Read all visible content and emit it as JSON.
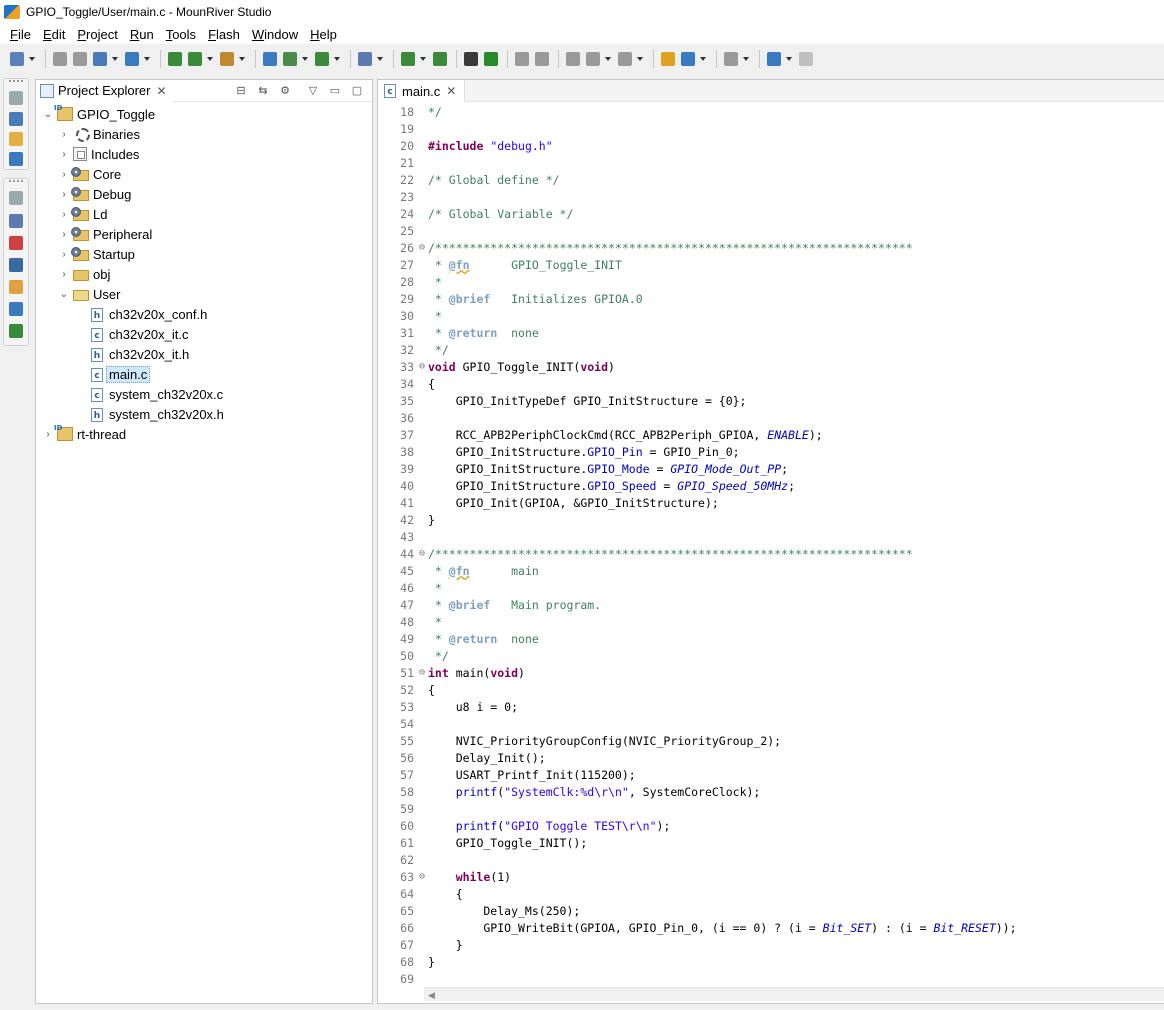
{
  "window": {
    "title": "GPIO_Toggle/User/main.c - MounRiver Studio"
  },
  "menu": [
    {
      "label": "File",
      "mnemonic": "F",
      "rest": "ile"
    },
    {
      "label": "Edit",
      "mnemonic": "E",
      "rest": "dit"
    },
    {
      "label": "Project",
      "mnemonic": "P",
      "rest": "roject"
    },
    {
      "label": "Run",
      "mnemonic": "R",
      "rest": "un"
    },
    {
      "label": "Tools",
      "mnemonic": "T",
      "rest": "ools"
    },
    {
      "label": "Flash",
      "mnemonic": "F",
      "rest": "lash"
    },
    {
      "label": "Window",
      "mnemonic": "W",
      "rest": "indow"
    },
    {
      "label": "Help",
      "mnemonic": "H",
      "rest": "elp"
    }
  ],
  "toolbar": {
    "buttons": [
      {
        "name": "new-icon",
        "color": "#5b7fb8"
      },
      {
        "name": "save-icon",
        "color": "#9a9a9a"
      },
      {
        "name": "save-all-icon",
        "color": "#9a9a9a"
      },
      {
        "name": "import-icon",
        "color": "#4a7ab8"
      },
      {
        "name": "build-config-icon",
        "color": "#3a7ac0"
      },
      {
        "name": "build-icon",
        "color": "#3a8a3a"
      },
      {
        "name": "build-all-icon",
        "color": "#3a8a3a"
      },
      {
        "name": "clean-icon",
        "color": "#c08a30"
      },
      {
        "name": "download-icon",
        "color": "#3a7ac0"
      },
      {
        "name": "target-icon",
        "color": "#4a8a4a"
      },
      {
        "name": "debug-icon",
        "color": "#3a8a3a"
      },
      {
        "name": "search-icon",
        "color": "#5a7ab0"
      },
      {
        "name": "device-icon",
        "color": "#3a8a3a"
      },
      {
        "name": "help-icon",
        "color": "#3a8a3a"
      },
      {
        "name": "terminal-icon",
        "color": "#3a3a3a"
      },
      {
        "name": "run-icon",
        "color": "#2a8a2a"
      },
      {
        "name": "step-over-icon",
        "color": "#9a9a9a"
      },
      {
        "name": "step-into-icon",
        "color": "#9a9a9a"
      },
      {
        "name": "step-return-icon",
        "color": "#9a9a9a"
      },
      {
        "name": "next-annotation-icon",
        "color": "#9a9a9a"
      },
      {
        "name": "prev-annotation-icon",
        "color": "#9a9a9a"
      },
      {
        "name": "last-edit-icon",
        "color": "#e0a020"
      },
      {
        "name": "back-icon",
        "color": "#3a7ac0"
      },
      {
        "name": "forward-icon",
        "color": "#9a9a9a"
      },
      {
        "name": "pin-editor-icon",
        "color": "#3a7ac0"
      },
      {
        "name": "unpin-icon",
        "color": "#c0c0c0"
      }
    ]
  },
  "explorer": {
    "title": "Project Explorer",
    "root": {
      "label": "GPIO_Toggle"
    },
    "items": [
      {
        "label": "Binaries",
        "icon": "binaries-icon",
        "level": 1,
        "expanded": false
      },
      {
        "label": "Includes",
        "icon": "includes-icon",
        "level": 1,
        "expanded": false
      },
      {
        "label": "Core",
        "icon": "source-folder-icon",
        "level": 1,
        "expanded": false
      },
      {
        "label": "Debug",
        "icon": "source-folder-icon",
        "level": 1,
        "expanded": false
      },
      {
        "label": "Ld",
        "icon": "source-folder-icon",
        "level": 1,
        "expanded": false
      },
      {
        "label": "Peripheral",
        "icon": "source-folder-icon",
        "level": 1,
        "expanded": false
      },
      {
        "label": "Startup",
        "icon": "source-folder-icon",
        "level": 1,
        "expanded": false
      },
      {
        "label": "obj",
        "icon": "folder-icon",
        "level": 1,
        "expanded": false
      },
      {
        "label": "User",
        "icon": "folder-open-icon",
        "level": 1,
        "expanded": true
      },
      {
        "label": "ch32v20x_conf.h",
        "icon": "header-file-icon",
        "level": 2,
        "kind": "h"
      },
      {
        "label": "ch32v20x_it.c",
        "icon": "c-file-icon",
        "level": 2,
        "kind": "c"
      },
      {
        "label": "ch32v20x_it.h",
        "icon": "header-file-icon",
        "level": 2,
        "kind": "h"
      },
      {
        "label": "main.c",
        "icon": "c-file-icon",
        "level": 2,
        "kind": "c",
        "selected": true
      },
      {
        "label": "system_ch32v20x.c",
        "icon": "c-file-icon",
        "level": 2,
        "kind": "c"
      },
      {
        "label": "system_ch32v20x.h",
        "icon": "header-file-icon",
        "level": 2,
        "kind": "h"
      }
    ],
    "second_project": {
      "label": "rt-thread"
    }
  },
  "editor": {
    "tab_label": "main.c",
    "lines": [
      {
        "n": "18",
        "text": "*/",
        "cls": "cm"
      },
      {
        "n": "19",
        "text": ""
      },
      {
        "n": "20",
        "text": "#include \"debug.h\""
      },
      {
        "n": "21",
        "text": ""
      },
      {
        "n": "22",
        "text": "/* Global define */",
        "cls": "cm"
      },
      {
        "n": "23",
        "text": ""
      },
      {
        "n": "24",
        "text": "/* Global Variable */",
        "cls": "cm"
      },
      {
        "n": "25",
        "text": ""
      },
      {
        "n": "26",
        "text": "/*********************************************************************",
        "cls": "cm",
        "fold": true
      },
      {
        "n": "27",
        "text": " * @fn      GPIO_Toggle_INIT",
        "cls": "cm"
      },
      {
        "n": "28",
        "text": " *",
        "cls": "cm"
      },
      {
        "n": "29",
        "text": " * @brief   Initializes GPIOA.0",
        "cls": "cm"
      },
      {
        "n": "30",
        "text": " *",
        "cls": "cm"
      },
      {
        "n": "31",
        "text": " * @return  none",
        "cls": "cm"
      },
      {
        "n": "32",
        "text": " */",
        "cls": "cm"
      },
      {
        "n": "33",
        "text": "void GPIO_Toggle_INIT(void)",
        "fold": true
      },
      {
        "n": "34",
        "text": "{"
      },
      {
        "n": "35",
        "text": "    GPIO_InitTypeDef GPIO_InitStructure = {0};"
      },
      {
        "n": "36",
        "text": ""
      },
      {
        "n": "37",
        "text": "    RCC_APB2PeriphClockCmd(RCC_APB2Periph_GPIOA, ENABLE);"
      },
      {
        "n": "38",
        "text": "    GPIO_InitStructure.GPIO_Pin = GPIO_Pin_0;"
      },
      {
        "n": "39",
        "text": "    GPIO_InitStructure.GPIO_Mode = GPIO_Mode_Out_PP;"
      },
      {
        "n": "40",
        "text": "    GPIO_InitStructure.GPIO_Speed = GPIO_Speed_50MHz;"
      },
      {
        "n": "41",
        "text": "    GPIO_Init(GPIOA, &GPIO_InitStructure);"
      },
      {
        "n": "42",
        "text": "}"
      },
      {
        "n": "43",
        "text": ""
      },
      {
        "n": "44",
        "text": "/*********************************************************************",
        "cls": "cm",
        "fold": true
      },
      {
        "n": "45",
        "text": " * @fn      main",
        "cls": "cm"
      },
      {
        "n": "46",
        "text": " *",
        "cls": "cm"
      },
      {
        "n": "47",
        "text": " * @brief   Main program.",
        "cls": "cm"
      },
      {
        "n": "48",
        "text": " *",
        "cls": "cm"
      },
      {
        "n": "49",
        "text": " * @return  none",
        "cls": "cm"
      },
      {
        "n": "50",
        "text": " */",
        "cls": "cm"
      },
      {
        "n": "51",
        "text": "int main(void)",
        "fold": true
      },
      {
        "n": "52",
        "text": "{"
      },
      {
        "n": "53",
        "text": "    u8 i = 0;"
      },
      {
        "n": "54",
        "text": ""
      },
      {
        "n": "55",
        "text": "    NVIC_PriorityGroupConfig(NVIC_PriorityGroup_2);"
      },
      {
        "n": "56",
        "text": "    Delay_Init();"
      },
      {
        "n": "57",
        "text": "    USART_Printf_Init(115200);"
      },
      {
        "n": "58",
        "text": "    printf(\"SystemClk:%d\\r\\n\", SystemCoreClock);"
      },
      {
        "n": "59",
        "text": ""
      },
      {
        "n": "60",
        "text": "    printf(\"GPIO Toggle TEST\\r\\n\");"
      },
      {
        "n": "61",
        "text": "    GPIO_Toggle_INIT();"
      },
      {
        "n": "62",
        "text": ""
      },
      {
        "n": "63",
        "text": "    while(1)",
        "fold": true
      },
      {
        "n": "64",
        "text": "    {"
      },
      {
        "n": "65",
        "text": "        Delay_Ms(250);"
      },
      {
        "n": "66",
        "text": "        GPIO_WriteBit(GPIOA, GPIO_Pin_0, (i == 0) ? (i = Bit_SET) : (i = Bit_RESET));"
      },
      {
        "n": "67",
        "text": "    }"
      },
      {
        "n": "68",
        "text": "}"
      },
      {
        "n": "69",
        "text": ""
      }
    ]
  },
  "colors": {
    "keyword": "#7f0055",
    "comment": "#3f7f5f",
    "string": "#2a00ff",
    "macro": "#0000c0",
    "selection": "#cde8ff"
  }
}
